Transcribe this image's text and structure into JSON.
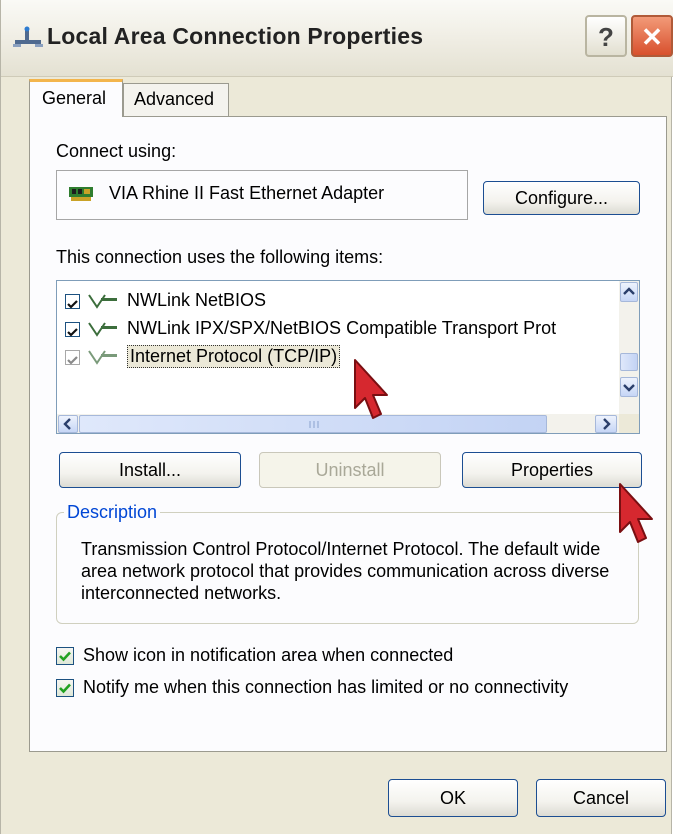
{
  "window": {
    "title": "Local Area Connection Properties",
    "help_glyph": "?",
    "close_glyph": "✕"
  },
  "tabs": [
    {
      "label": "General",
      "active": true
    },
    {
      "label": "Advanced",
      "active": false
    }
  ],
  "general": {
    "connect_using_label": "Connect using:",
    "adapter_name": "VIA Rhine II Fast Ethernet Adapter",
    "configure_label": "Configure...",
    "items_label": "This connection uses the following items:",
    "items": [
      {
        "label": "NWLink NetBIOS",
        "checked": true,
        "selected": false
      },
      {
        "label": "NWLink IPX/SPX/NetBIOS Compatible Transport Prot",
        "checked": true,
        "selected": false
      },
      {
        "label": "Internet Protocol (TCP/IP)",
        "checked": true,
        "selected": true
      }
    ],
    "install_label": "Install...",
    "uninstall_label": "Uninstall",
    "properties_label": "Properties",
    "description_legend": "Description",
    "description_text": "Transmission Control Protocol/Internet Protocol. The default wide area network protocol that provides communication across diverse interconnected networks.",
    "show_icon_label": "Show icon in notification area when connected",
    "show_icon_checked": true,
    "notify_label": "Notify me when this connection has limited or no connectivity",
    "notify_checked": true
  },
  "footer": {
    "ok_label": "OK",
    "cancel_label": "Cancel"
  },
  "colors": {
    "dialog_bg": "#ece9d8",
    "tab_highlight": "#f3b54c",
    "button_border": "#1c4e92",
    "legend_blue": "#0046d5",
    "cursor_red": "#d6282f"
  }
}
